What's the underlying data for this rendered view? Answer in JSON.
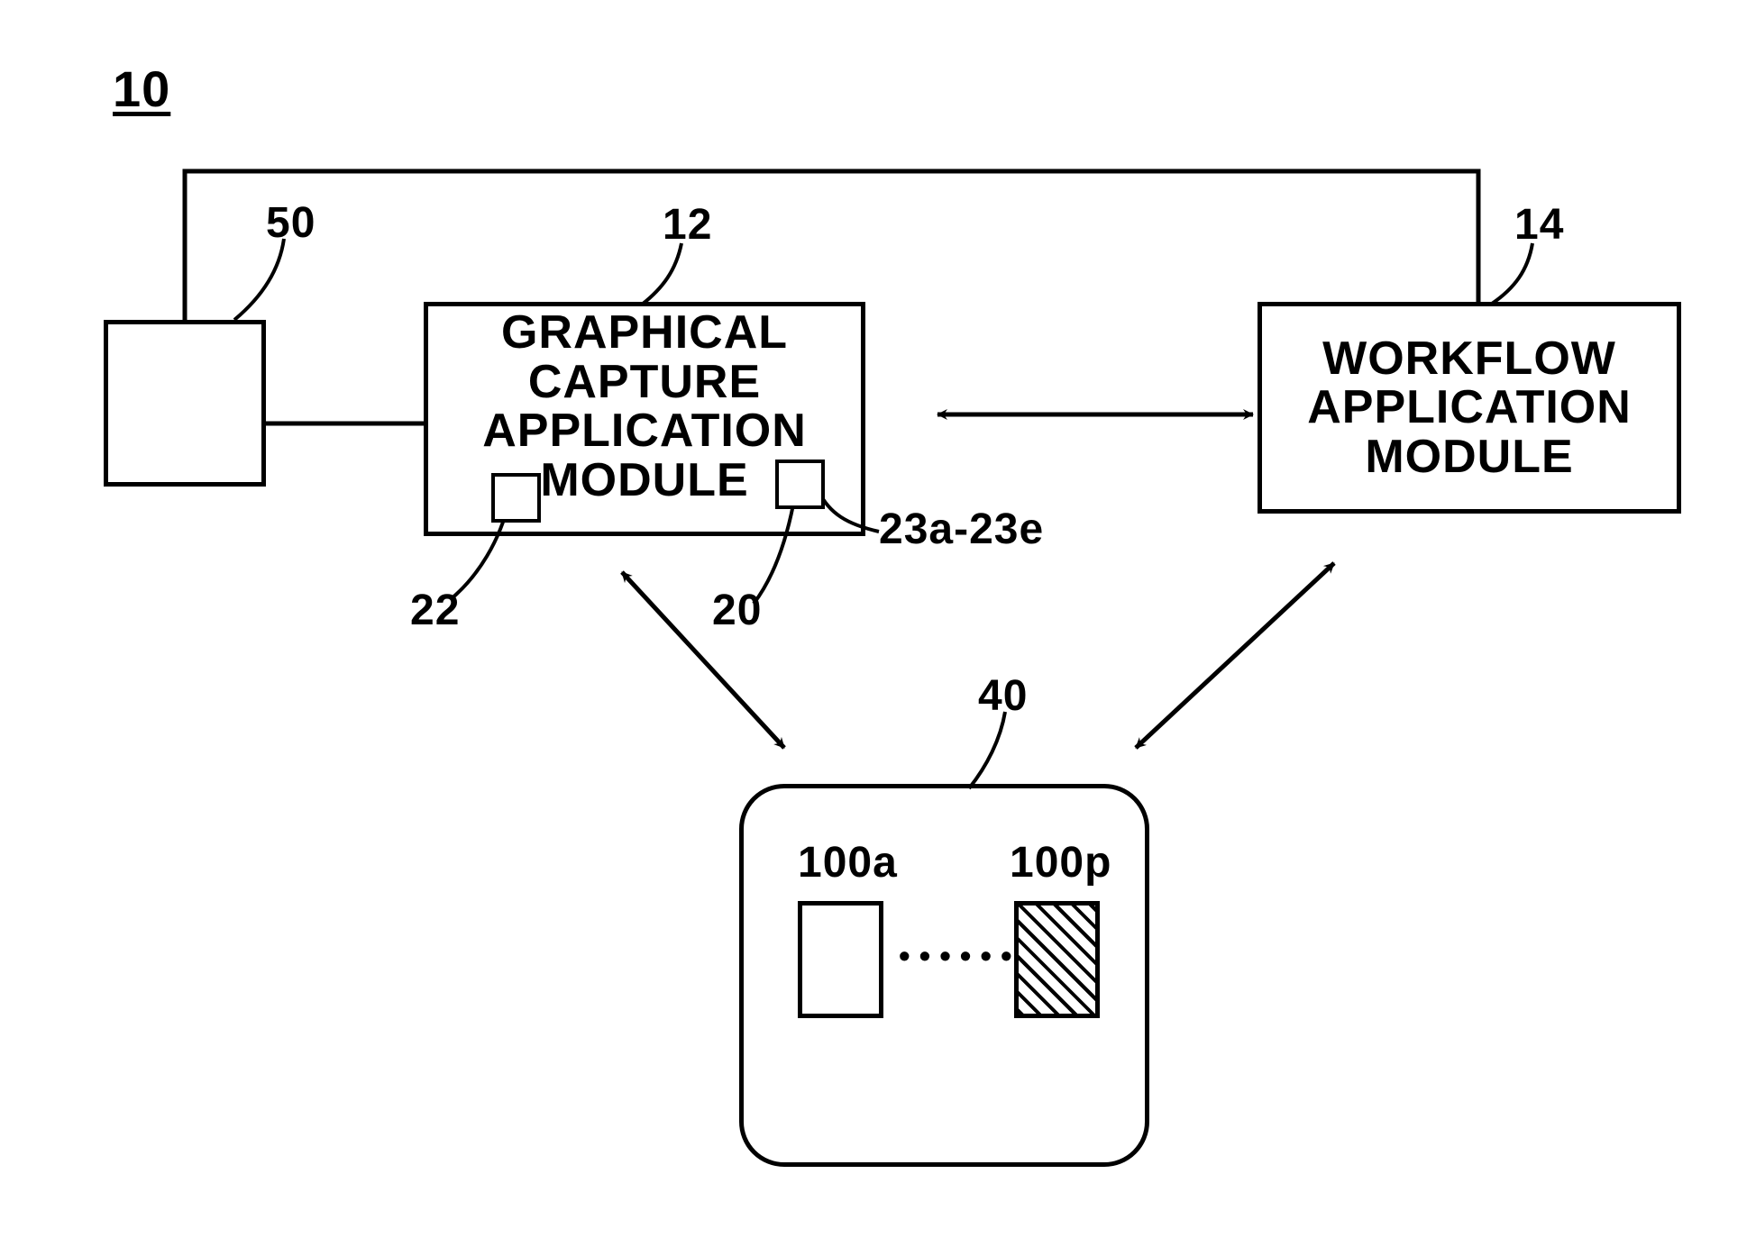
{
  "refs": {
    "system": "10",
    "module1": "12",
    "module2": "14",
    "sub_left": "22",
    "sub_right_inner": "20",
    "sub_right_outer": "23a-23e",
    "store": "40",
    "aux": "50",
    "item_first": "100a",
    "item_last": "100p"
  },
  "modules": {
    "capture_l1": "GRAPHICAL",
    "capture_l2": "CAPTURE",
    "capture_l3": "APPLICATION",
    "capture_l4": "MODULE",
    "workflow_l1": "WORKFLOW",
    "workflow_l2": "APPLICATION",
    "workflow_l3": "MODULE"
  },
  "dots": "••••••"
}
